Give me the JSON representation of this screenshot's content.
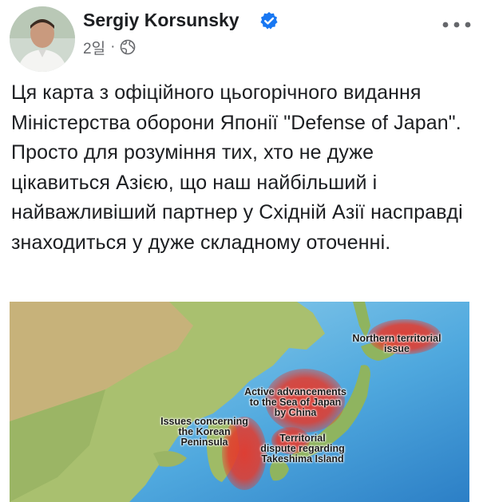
{
  "post": {
    "author_name": "Sergiy Korsunsky",
    "time": "2일",
    "separator": "·",
    "text": "Ця карта з офіційного цьогорічного видання Міністерства оборони Японії \"Defense of Japan\". Просто для розуміння тих, хто не дуже цікавиться Азією, що наш найбільший і найважливіший партнер у Східній Азії насправді знаходиться у дуже складному оточенні."
  },
  "icons": {
    "verified": "verified-badge-icon",
    "privacy": "globe-icon",
    "more": "more-options-icon"
  },
  "colors": {
    "verified_blue": "#1877f2",
    "meta_gray": "#65676b",
    "hotspot_red": "#e5392b"
  },
  "map": {
    "labels": {
      "northern": "Northern territorial\nissue",
      "active": "Active advancements\nto the Sea of Japan\nby China",
      "korea": "Issues concerning\nthe Korean\nPeninsula",
      "takeshima": "Territorial\ndispute regarding\nTakeshima Island"
    }
  }
}
